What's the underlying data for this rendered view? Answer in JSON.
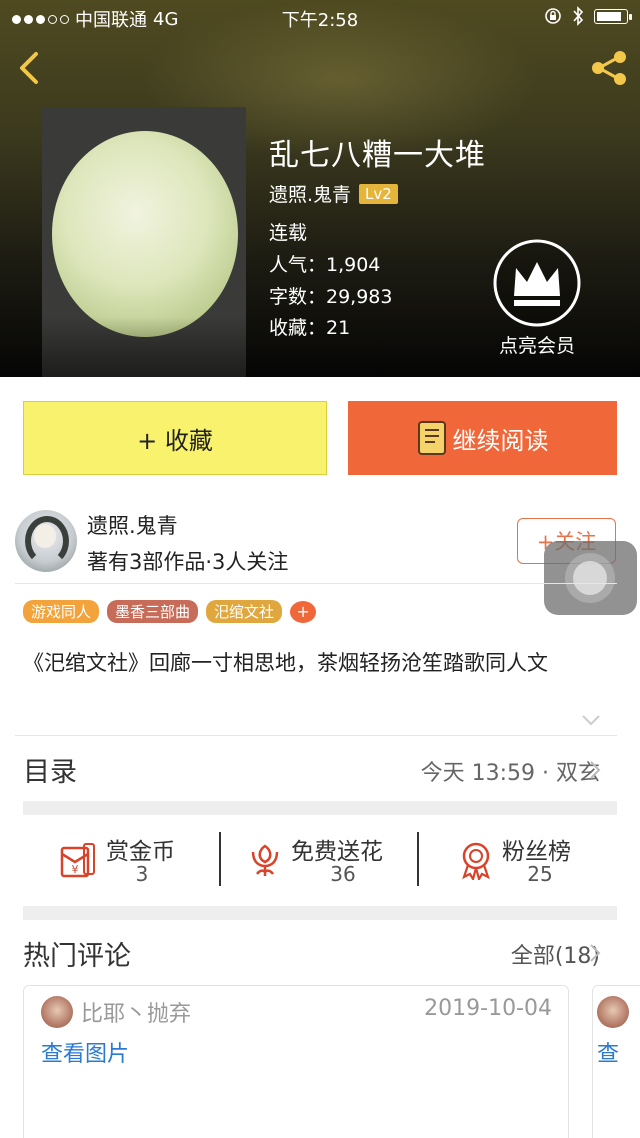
{
  "status_bar": {
    "carrier": "中国联通",
    "network": "4G",
    "time": "下午2:58"
  },
  "book": {
    "title": "乱七八糟一大堆",
    "author": "遗照.鬼青",
    "level": "Lv2",
    "status": "连载",
    "popularity": "人气：1,904",
    "word_count": "字数：29,983",
    "favorites": "收藏：21"
  },
  "vip": {
    "label": "点亮会员"
  },
  "actions": {
    "collect": "+ 收藏",
    "read": "继续阅读"
  },
  "author_section": {
    "name": "遗照.鬼青",
    "stats": "著有3部作品·3人关注",
    "follow": "+关注"
  },
  "tags": [
    {
      "label": "游戏同人",
      "color": "#f3a33b"
    },
    {
      "label": "墨香三部曲",
      "color": "#c86c5a"
    },
    {
      "label": "汜绾文社",
      "color": "#e0a73f"
    }
  ],
  "tag_add": "+",
  "description": "《汜绾文社》回廊一寸相思地，茶烟轻扬沧笙踏歌同人文",
  "toc": {
    "label": "目录",
    "latest": "今天 13:59 · 双玄"
  },
  "stats": [
    {
      "label": "赏金币",
      "value": "3",
      "icon": "red-envelope-icon"
    },
    {
      "label": "免费送花",
      "value": "36",
      "icon": "flower-icon"
    },
    {
      "label": "粉丝榜",
      "value": "25",
      "icon": "medal-icon"
    }
  ],
  "comments": {
    "label": "热门评论",
    "all": "全部(18)",
    "items": [
      {
        "user": "比耶丶抛弃",
        "date": "2019-10-04",
        "link": "查看图片"
      },
      {
        "link": "查"
      }
    ]
  },
  "colors": {
    "accent_orange": "#f0673a",
    "collect_yellow": "#f9f26d",
    "level_gold": "#e5b43a",
    "icon_red": "#d9432a",
    "link_blue": "#2a7ad3"
  }
}
